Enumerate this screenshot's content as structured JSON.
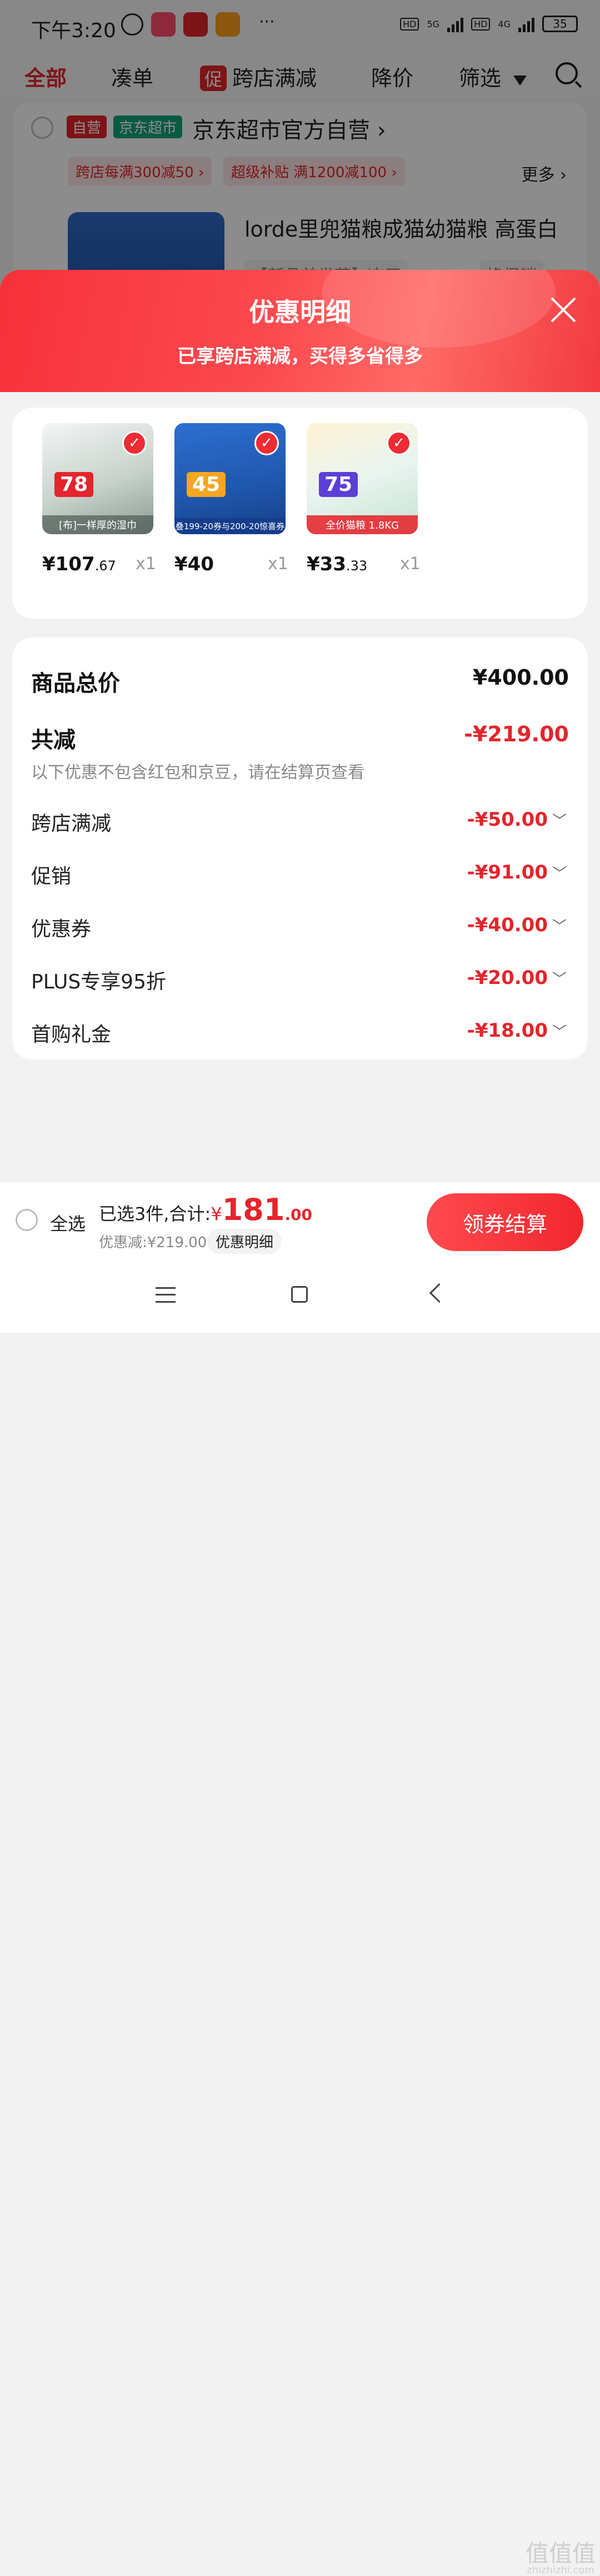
{
  "status_bar": {
    "time": "下午3:20",
    "network_1": "5G",
    "network_2": "4G",
    "hd_1": "HD",
    "hd_2": "HD",
    "battery": "35",
    "more": "···"
  },
  "tabs": {
    "all": "全部",
    "bundle": "凑单",
    "promo_tag": "促",
    "cross_store": "跨店满减",
    "price_drop": "降价",
    "filter": "筛选"
  },
  "shop": {
    "badge_self": "自营",
    "badge_market": "京东超市",
    "name": "京东超市官方自营 ›",
    "coupon_1": "跨店每满300减50 ›",
    "coupon_2": "超级补贴 满1200减100 ›",
    "more": "更多 ›",
    "product_title": "lorde里兜猫粮成猫幼猫粮 高蛋白",
    "product_sub": "【新品首发荐】冻干",
    "product_sub2": "换促销"
  },
  "sheet": {
    "title": "优惠明细",
    "subtitle": "已享跨店满减，买得多省得多"
  },
  "items": [
    {
      "price_main": "¥107",
      "price_dec": ".67",
      "qty": "x1",
      "img_caption": "[布]一样厚的湿巾",
      "img_big": "78"
    },
    {
      "price_main": "¥40",
      "price_dec": "",
      "qty": "x1",
      "img_caption": "叠199-20券与200-20惊喜券",
      "img_big": "45"
    },
    {
      "price_main": "¥33",
      "price_dec": ".33",
      "qty": "x1",
      "img_caption": "全价猫粮 1.8KG",
      "img_big": "75"
    }
  ],
  "summary": {
    "total_label": "商品总价",
    "total_value": "¥400.00",
    "reduce_label": "共减",
    "reduce_value": "-¥219.00",
    "note": "以下优惠不包含红包和京豆，请在结算页查看",
    "lines": [
      {
        "label": "跨店满减",
        "value": "-¥50.00"
      },
      {
        "label": "促销",
        "value": "-¥91.00"
      },
      {
        "label": "优惠券",
        "value": "-¥40.00"
      },
      {
        "label": "PLUS专享95折",
        "value": "-¥20.00"
      },
      {
        "label": "首购礼金",
        "value": "-¥18.00"
      }
    ]
  },
  "bottom": {
    "select_all": "全选",
    "selected_prefix": "已选3件,合计:",
    "total_symbol": "¥",
    "total_int": "181",
    "total_dec": ".00",
    "discount": "优惠减:¥219.00",
    "detail_chip": "优惠明细",
    "checkout": "领券结算"
  },
  "watermark": {
    "main": "值值值",
    "sub": "zhizhizhi.com"
  },
  "colors": {
    "accent": "#e4252b",
    "header_gradient_start": "#f7313a",
    "header_gradient_end": "#ff6a66"
  },
  "icons": [
    "alarm-icon",
    "signal-icon",
    "battery-icon",
    "filter-icon",
    "search-icon",
    "close-icon",
    "check-icon",
    "chevron-down-icon",
    "nav-menu-icon",
    "nav-home-icon",
    "nav-back-icon"
  ]
}
